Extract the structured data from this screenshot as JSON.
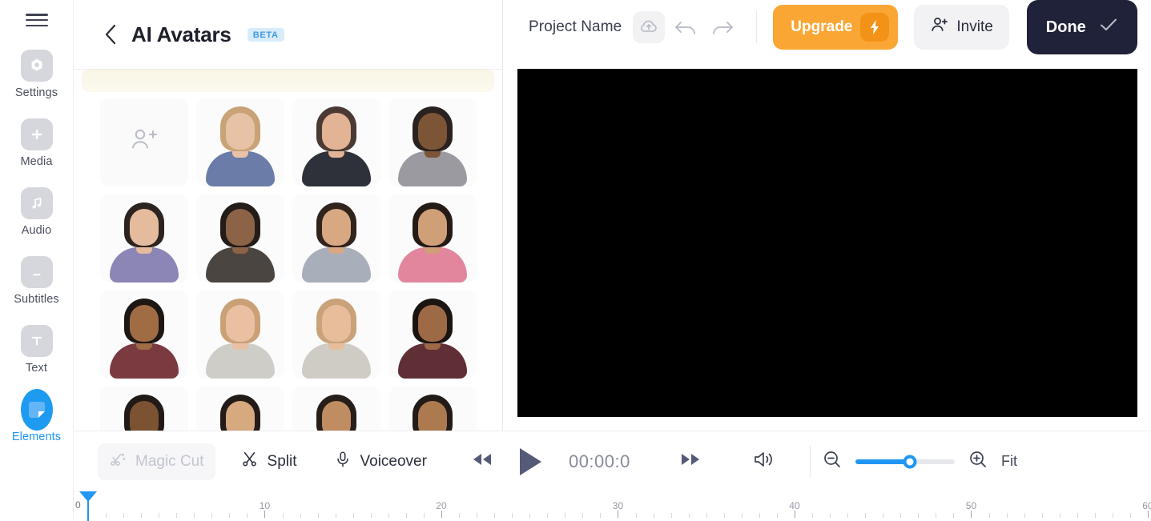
{
  "rail": {
    "menu_icon": "hamburger-icon",
    "items": [
      {
        "label": "Settings",
        "icon": "gear-icon",
        "active": false
      },
      {
        "label": "Media",
        "icon": "plus-square-icon",
        "active": false
      },
      {
        "label": "Audio",
        "icon": "music-note-icon",
        "active": false
      },
      {
        "label": "Subtitles",
        "icon": "subtitles-icon",
        "active": false
      },
      {
        "label": "Text",
        "icon": "text-t-icon",
        "active": false
      },
      {
        "label": "Elements",
        "icon": "elements-icon",
        "active": true
      }
    ]
  },
  "panel": {
    "back_icon": "chevron-left-icon",
    "title": "AI Avatars",
    "badge": "BETA",
    "add_avatar_icon": "person-add-icon",
    "avatars": [
      {
        "name": "add-avatar",
        "placeholder": true
      },
      {
        "name": "avatar-blonde-blue-top",
        "skin": "#e8c2a6",
        "hair": "#c9a276",
        "cloth": "#6b7ca8"
      },
      {
        "name": "avatar-dark-hair-blazer",
        "skin": "#e3b395",
        "hair": "#4a3a33",
        "cloth": "#2e3139"
      },
      {
        "name": "avatar-bearded-man-grey",
        "skin": "#7c5436",
        "hair": "#2a2220",
        "cloth": "#9a9aa0"
      },
      {
        "name": "avatar-woman-long-hair",
        "skin": "#e5bb9d",
        "hair": "#2c2420",
        "cloth": "#8b86b6"
      },
      {
        "name": "avatar-woman-dark-blazer",
        "skin": "#8c6346",
        "hair": "#241c19",
        "cloth": "#4a4540"
      },
      {
        "name": "avatar-man-suit-tie",
        "skin": "#d8a883",
        "hair": "#30241d",
        "cloth": "#a9aebb"
      },
      {
        "name": "avatar-woman-pink-top",
        "skin": "#cf9f77",
        "hair": "#241a16",
        "cloth": "#e2869e"
      },
      {
        "name": "avatar-man-maroon-shirt",
        "skin": "#a06c44",
        "hair": "#1d1714",
        "cloth": "#7a3a40"
      },
      {
        "name": "avatar-woman-grey-knit",
        "skin": "#e9c0a2",
        "hair": "#caa077",
        "cloth": "#cfcdc8"
      },
      {
        "name": "avatar-woman-beige-top",
        "skin": "#e7bd9b",
        "hair": "#c9a27a",
        "cloth": "#cfccc5"
      },
      {
        "name": "avatar-man-dark-maroon",
        "skin": "#9d6a45",
        "hair": "#1b1512",
        "cloth": "#5f2f35"
      },
      {
        "name": "avatar-man-beard-row4",
        "skin": "#7b5232",
        "hair": "#211a17",
        "cloth": "#8c8a90"
      },
      {
        "name": "avatar-woman-row4",
        "skin": "#d7a97f",
        "hair": "#231b17",
        "cloth": "#6e6d74"
      },
      {
        "name": "avatar-man-white-shirt",
        "skin": "#c08c61",
        "hair": "#271e1a",
        "cloth": "#d8d9de"
      },
      {
        "name": "avatar-man-row4-last",
        "skin": "#ad7a50",
        "hair": "#231b18",
        "cloth": "#7e7d84"
      }
    ]
  },
  "topbar": {
    "project_name": "Project Name",
    "cloud_icon": "cloud-save-icon",
    "undo_icon": "undo-arrow-icon",
    "redo_icon": "redo-arrow-icon",
    "upgrade_label": "Upgrade",
    "upgrade_icon": "lightning-bolt-icon",
    "invite_label": "Invite",
    "invite_icon": "person-add-icon",
    "done_label": "Done",
    "done_icon": "check-icon",
    "colors": {
      "upgrade_bg": "#faa634",
      "upgrade_chip": "#f29318",
      "done_bg": "#1f2238",
      "invite_bg": "#f2f2f5",
      "accent_blue": "#2196f3",
      "beta_bg": "#d9ecfb",
      "beta_text": "#3f9ae0"
    }
  },
  "stage": {
    "canvas_color": "#000000"
  },
  "toolbar": {
    "magic_cut_label": "Magic Cut",
    "magic_cut_icon": "magic-scissors-icon",
    "split_label": "Split",
    "split_icon": "scissors-icon",
    "voiceover_label": "Voiceover",
    "voiceover_icon": "microphone-icon",
    "rewind_icon": "rewind-icon",
    "play_icon": "play-icon",
    "forward_icon": "fast-forward-icon",
    "volume_icon": "speaker-icon",
    "timecode": "00:00:0",
    "zoom_out_icon": "zoom-out-icon",
    "zoom_in_icon": "zoom-in-icon",
    "zoom_value": 55,
    "fit_label": "Fit"
  },
  "timeline": {
    "playhead_position": 0,
    "playhead_label": "0",
    "major_ticks": [
      {
        "label": "10",
        "value": 10
      },
      {
        "label": "20",
        "value": 20
      },
      {
        "label": "30",
        "value": 30
      },
      {
        "label": "40",
        "value": 40
      },
      {
        "label": "50",
        "value": 50
      },
      {
        "label": "60",
        "value": 60
      }
    ],
    "range_start": 0,
    "range_end": 61
  }
}
